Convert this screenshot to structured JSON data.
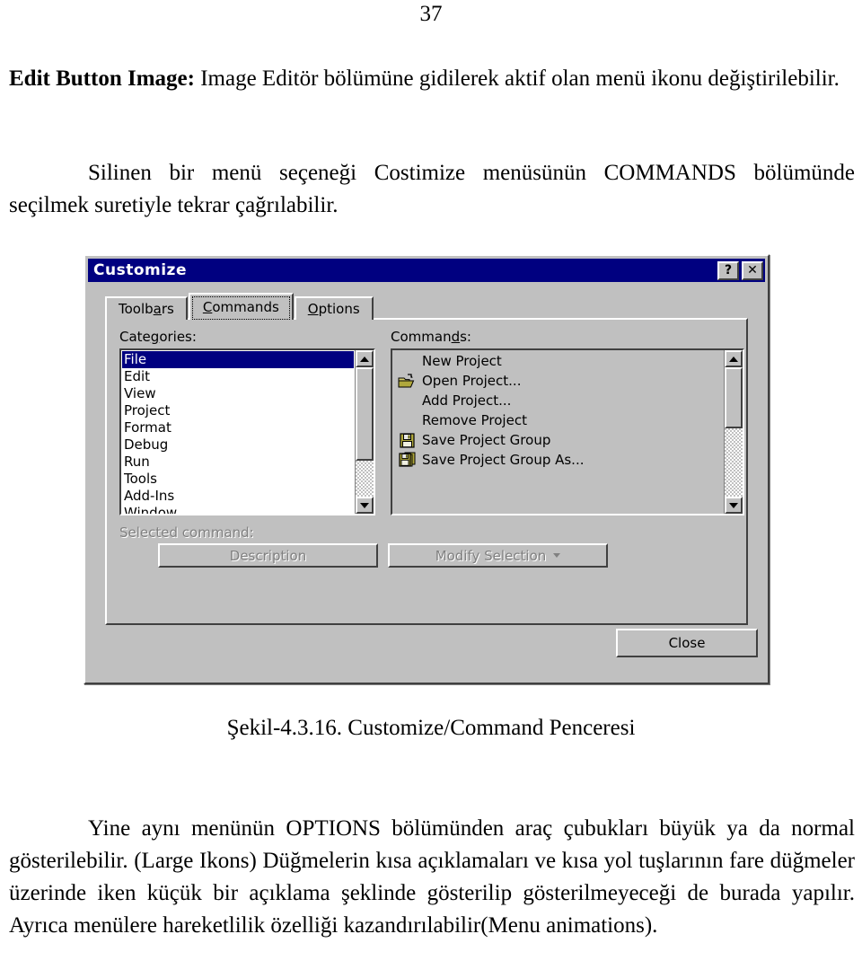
{
  "document": {
    "page_number": "37",
    "paragraph_1_bold": "Edit Button Image:",
    "paragraph_1_rest": " Image Editör bölümüne gidilerek aktif olan menü ikonu değiştirilebilir.",
    "paragraph_2": "Silinen bir menü seçeneği Costimize menüsünün COMMANDS bölümünde seçilmek suretiyle tekrar çağrılabilir.",
    "figure_caption": "Şekil-4.3.16. Customize/Command Penceresi",
    "paragraph_3": "Yine aynı menünün OPTIONS bölümünden araç çubukları büyük ya da normal gösterilebilir. (Large Ikons) Düğmelerin kısa açıklamaları ve kısa yol tuşlarının fare düğmeler üzerinde iken küçük bir açıklama şeklinde gösterilip gösterilmeyeceği de burada yapılır. Ayrıca menülere hareketlilik özelliği kazandırılabilir(Menu animations)."
  },
  "dialog": {
    "title": "Customize",
    "titlebar_color": "#000080",
    "face_color": "#c0c0c0",
    "help_button_label": "?",
    "close_button_label": "✕",
    "tabs": [
      {
        "label": "Toolbars",
        "accel_index": 5,
        "selected": false
      },
      {
        "label": "Commands",
        "accel_index": 0,
        "selected": true
      },
      {
        "label": "Options",
        "accel_index": 0,
        "selected": false
      }
    ],
    "categories": {
      "label_pre": "Cate",
      "label_accel": "g",
      "label_post": "ories:",
      "items": [
        {
          "label": "File",
          "selected": true
        },
        {
          "label": "Edit",
          "selected": false
        },
        {
          "label": "View",
          "selected": false
        },
        {
          "label": "Project",
          "selected": false
        },
        {
          "label": "Format",
          "selected": false
        },
        {
          "label": "Debug",
          "selected": false
        },
        {
          "label": "Run",
          "selected": false
        },
        {
          "label": "Tools",
          "selected": false
        },
        {
          "label": "Add-Ins",
          "selected": false
        },
        {
          "label": "Window",
          "selected": false
        }
      ],
      "scroll_thumb_top_pct": 0,
      "scroll_thumb_height_pct": 72
    },
    "commands": {
      "label_pre": "Comman",
      "label_accel": "d",
      "label_post": "s:",
      "items": [
        {
          "label": "New Project",
          "icon": "none"
        },
        {
          "label": "Open Project...",
          "icon": "open-folder-icon"
        },
        {
          "label": "Add Project...",
          "icon": "none"
        },
        {
          "label": "Remove Project",
          "icon": "none"
        },
        {
          "label": "Save Project Group",
          "icon": "floppy-disk-icon"
        },
        {
          "label": "Save Project Group As...",
          "icon": "floppy-disk-stack-icon"
        }
      ],
      "scroll_thumb_top_pct": 0,
      "scroll_thumb_height_pct": 47
    },
    "selected_command_label": "Selected command:",
    "description_button": "Description",
    "modify_selection_button": "Modify Selection",
    "close_button": "Close"
  }
}
